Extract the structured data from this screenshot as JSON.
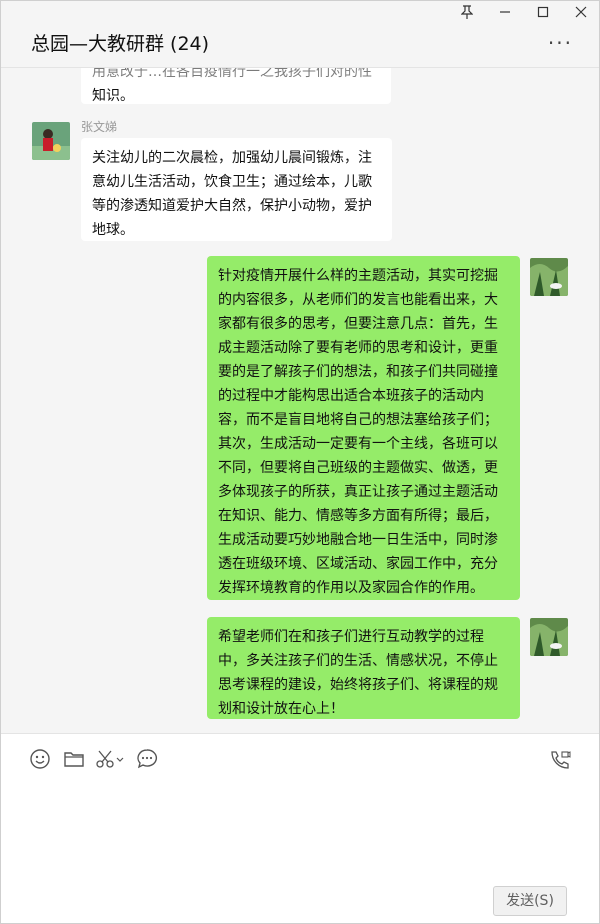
{
  "window": {
    "title": "总园—大教研群 (24)",
    "controls": {
      "pin": "⌆",
      "minimize": "—",
      "maximize": "☐",
      "close": "✕"
    },
    "more": "···"
  },
  "messages": [
    {
      "side": "left",
      "sender": "",
      "text_line_partial": "...",
      "text": "知识。"
    },
    {
      "side": "left",
      "sender": "张文娣",
      "text": "关注幼儿的二次晨检，加强幼儿晨间锻炼，注意幼儿生活活动，饮食卫生；通过绘本，儿歌等的渗透知道爱护大自然，保护小动物，爱护地球。"
    },
    {
      "side": "right",
      "sender": "",
      "text": "针对疫情开展什么样的主题活动，其实可挖掘的内容很多，从老师们的发言也能看出来，大家都有很多的思考，但要注意几点：首先，生成主题活动除了要有老师的思考和设计，更重要的是了解孩子们的想法，和孩子们共同碰撞的过程中才能构思出适合本班孩子的活动内容，而不是盲目地将自己的想法塞给孩子们；其次，生成活动一定要有一个主线，各班可以不同，但要将自己班级的主题做实、做透，更多体现孩子的所获，真正让孩子通过主题活动在知识、能力、情感等多方面有所得；最后，生成活动要巧妙地融合地一日生活中，同时渗透在班级环境、区域活动、家园工作中，充分发挥环境教育的作用以及家园合作的作用。"
    },
    {
      "side": "right",
      "sender": "",
      "text": "希望老师们在和孩子们进行互动教学的过程中，多关注孩子们的生活、情感状况，不停止思考课程的建设，始终将孩子们、将课程的规划和设计放在心上！"
    }
  ],
  "toolbar": {
    "icons": [
      "emoji-icon",
      "folder-icon",
      "scissors-icon",
      "chat-history-icon",
      "video-call-icon"
    ]
  },
  "composer": {
    "send_label": "发送(S)"
  },
  "colors": {
    "outgoing_bubble": "#95ec69",
    "incoming_bubble": "#ffffff",
    "background": "#f5f5f5"
  }
}
